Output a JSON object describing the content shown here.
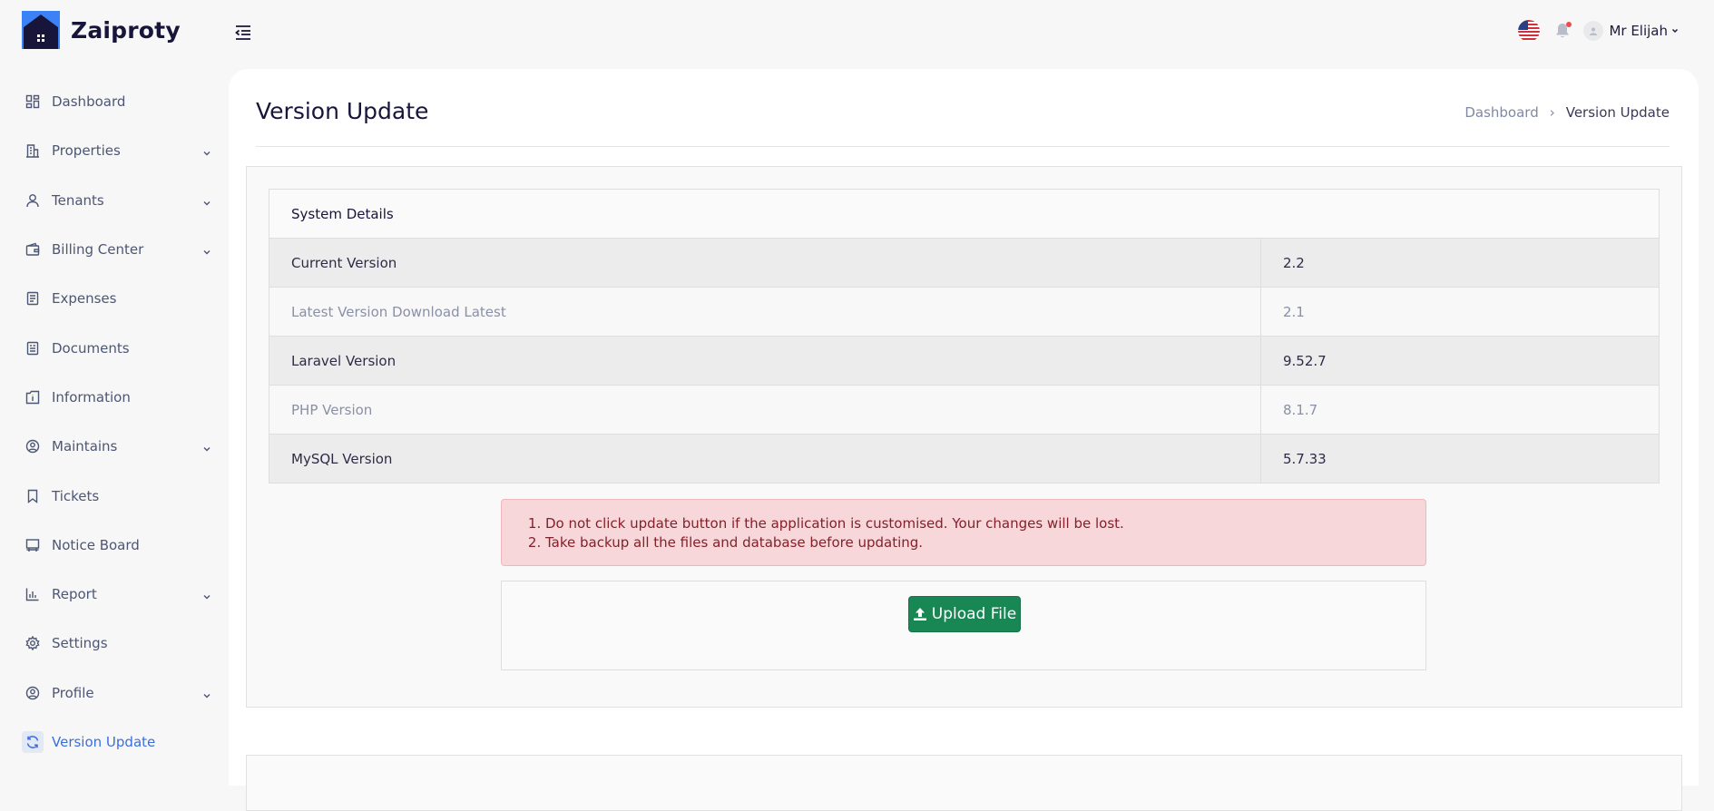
{
  "brand": {
    "name": "Zaiproty",
    "accent": "#3a6ee0",
    "dark": "#18153a"
  },
  "sidebar": {
    "items": [
      {
        "label": "Dashboard",
        "icon": "dashboard-icon",
        "has_submenu": false
      },
      {
        "label": "Properties",
        "icon": "building-icon",
        "has_submenu": true
      },
      {
        "label": "Tenants",
        "icon": "user-icon",
        "has_submenu": true
      },
      {
        "label": "Billing Center",
        "icon": "wallet-icon",
        "has_submenu": true
      },
      {
        "label": "Expenses",
        "icon": "receipt-icon",
        "has_submenu": false
      },
      {
        "label": "Documents",
        "icon": "document-icon",
        "has_submenu": false
      },
      {
        "label": "Information",
        "icon": "info-icon",
        "has_submenu": false
      },
      {
        "label": "Maintains",
        "icon": "user-circle-icon",
        "has_submenu": true
      },
      {
        "label": "Tickets",
        "icon": "bookmark-icon",
        "has_submenu": false
      },
      {
        "label": "Notice Board",
        "icon": "board-icon",
        "has_submenu": false
      },
      {
        "label": "Report",
        "icon": "chart-icon",
        "has_submenu": true
      },
      {
        "label": "Settings",
        "icon": "gear-icon",
        "has_submenu": false
      },
      {
        "label": "Profile",
        "icon": "profile-icon",
        "has_submenu": true
      },
      {
        "label": "Version Update",
        "icon": "refresh-icon",
        "has_submenu": false,
        "active": true
      }
    ]
  },
  "header": {
    "language_flag": "us-flag-icon",
    "notification_icon": "bell-icon",
    "user_name": "Mr Elijah"
  },
  "page": {
    "title": "Version Update",
    "breadcrumb": {
      "home": "Dashboard",
      "current": "Version Update"
    }
  },
  "system_details": {
    "heading": "System Details",
    "rows": [
      {
        "label": "Current Version",
        "value": "2.2"
      },
      {
        "label": "Latest Version Download Latest",
        "value": "2.1"
      },
      {
        "label": "Laravel Version",
        "value": "9.52.7"
      },
      {
        "label": "PHP Version",
        "value": "8.1.7"
      },
      {
        "label": "MySQL Version",
        "value": "5.7.33"
      }
    ]
  },
  "warnings": [
    "Do not click update button if the application is customised. Your changes will be lost.",
    "Take backup all the files and database before updating."
  ],
  "upload": {
    "label": "Upload File",
    "color": "#198754"
  }
}
